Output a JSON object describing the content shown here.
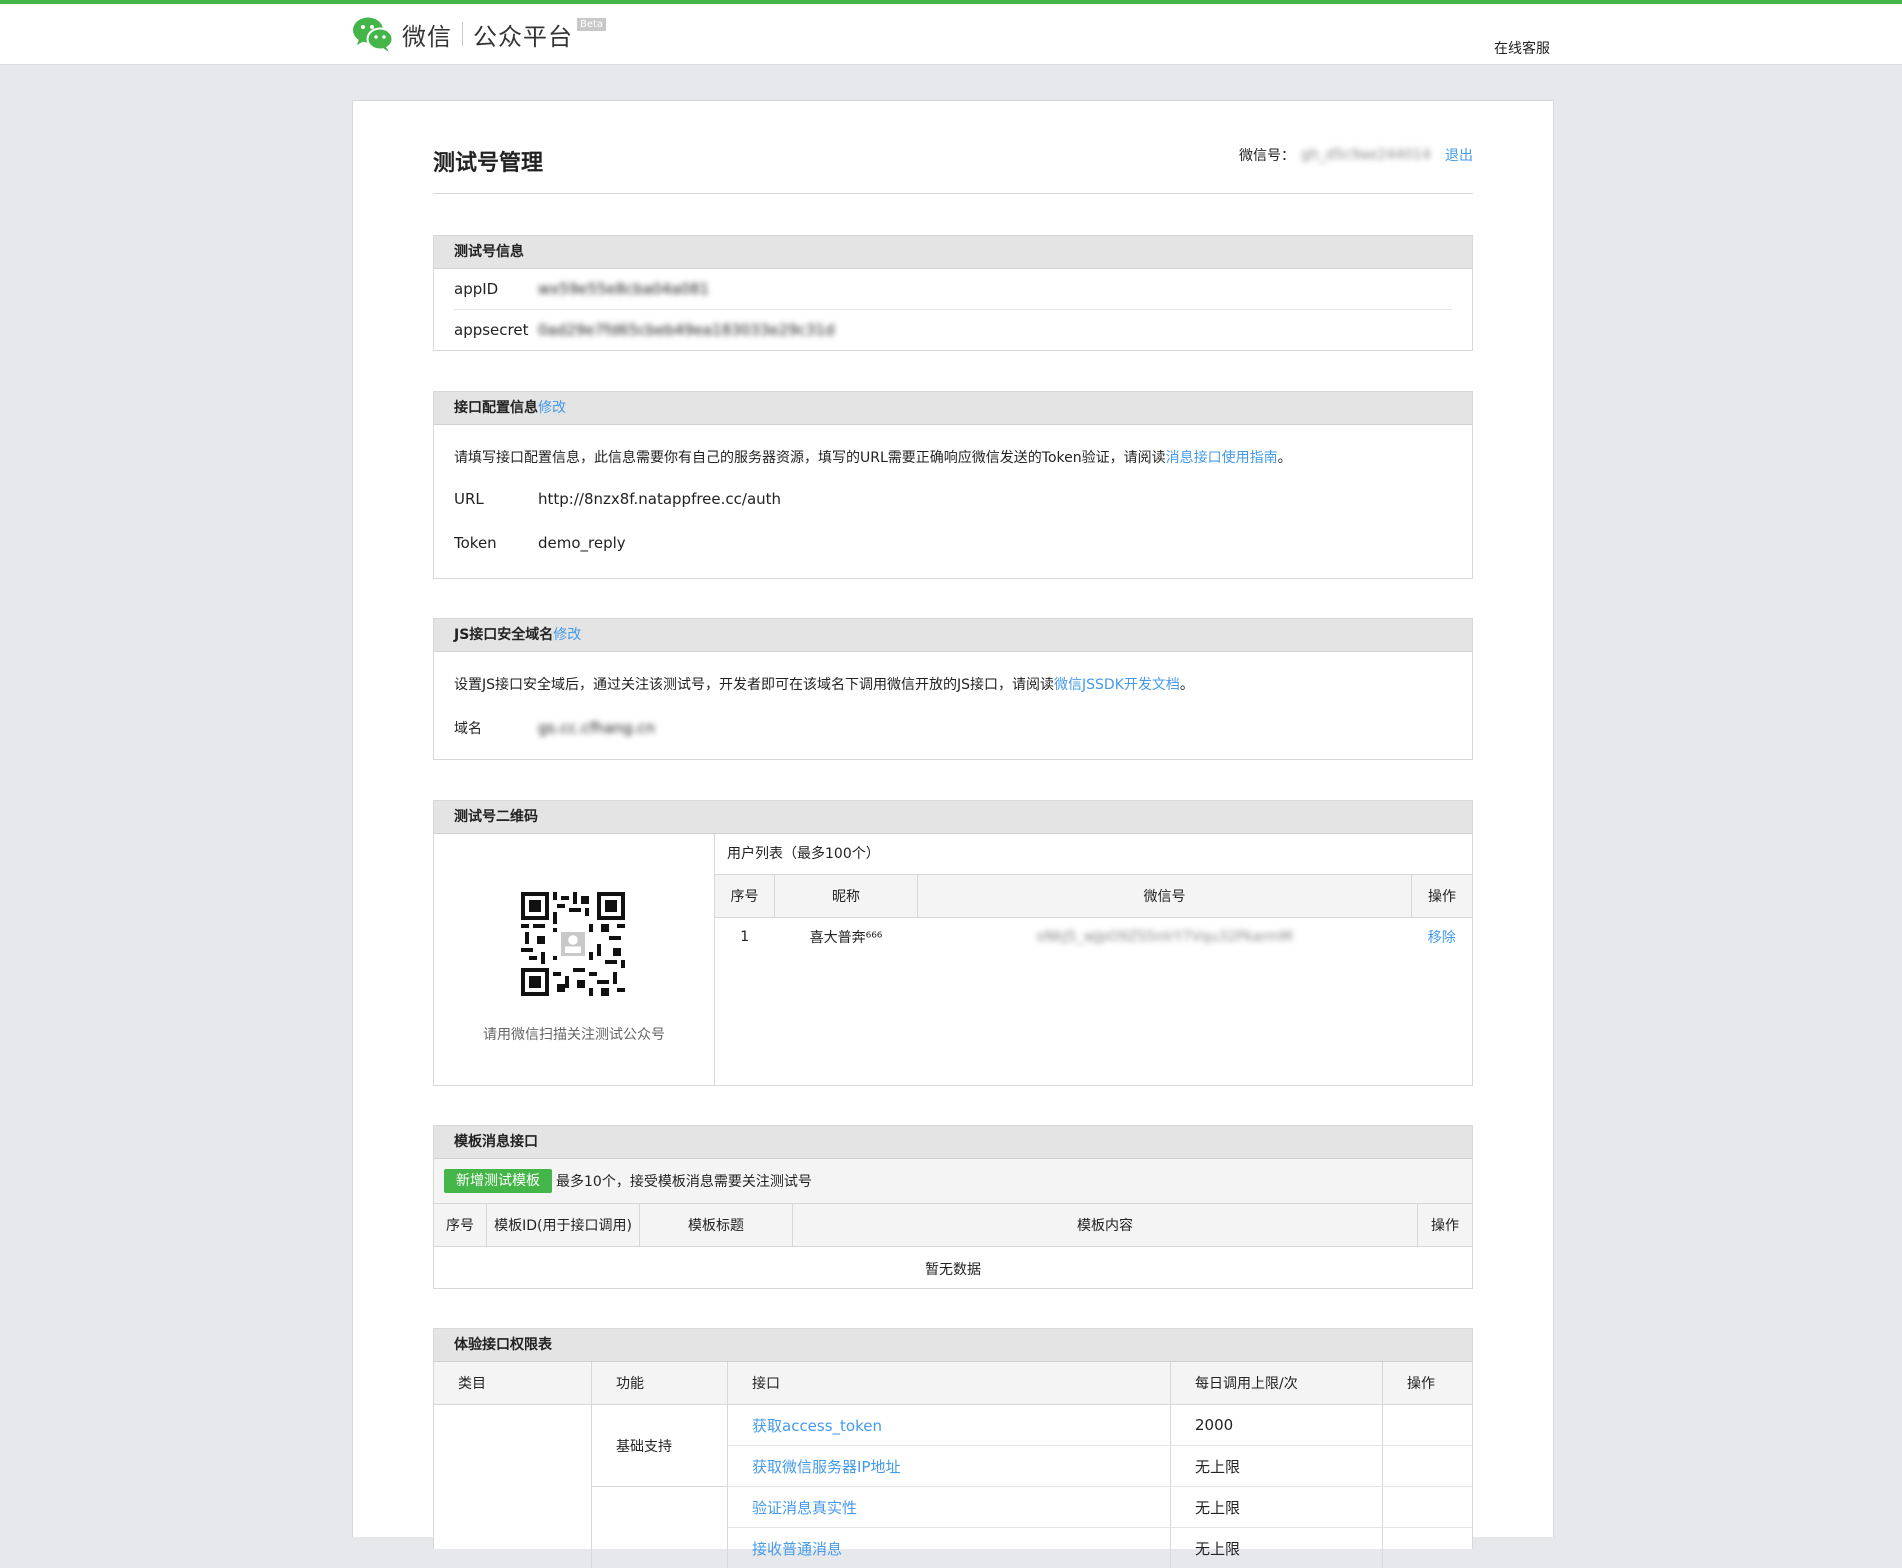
{
  "header": {
    "brand": "微信",
    "platform": "公众平台",
    "beta": "Beta",
    "help": "在线客服"
  },
  "page": {
    "title": "测试号管理",
    "account_label": "微信号：",
    "account_value": "gh_d5c9ae244014",
    "logout": "退出"
  },
  "test_info": {
    "title": "测试号信息",
    "appid_label": "appID",
    "appid_value": "wx59e55e8cba04a081",
    "secret_label": "appsecret",
    "secret_value": "0ad29e7fd65cbeb49ea183033e29c31d"
  },
  "api_config": {
    "title": "接口配置信息",
    "edit": "修改",
    "desc": "请填写接口配置信息，此信息需要你有自己的服务器资源，填写的URL需要正确响应微信发送的Token验证，请阅读",
    "desc_link": "消息接口使用指南",
    "desc_end": "。",
    "url_label": "URL",
    "url_value": "http://8nzx8f.natappfree.cc/auth",
    "token_label": "Token",
    "token_value": "demo_reply"
  },
  "js_domain": {
    "title": "JS接口安全域名",
    "edit": "修改",
    "desc": "设置JS接口安全域后，通过关注该测试号，开发者即可在该域名下调用微信开放的JS接口，请阅读",
    "desc_link": "微信JSSDK开发文档",
    "desc_end": "。",
    "domain_label": "域名",
    "domain_value": "gs.cc.cfhang.cn"
  },
  "qr": {
    "title": "测试号二维码",
    "caption": "请用微信扫描关注测试公众号",
    "list_title": "用户列表（最多100个）",
    "columns": [
      "序号",
      "昵称",
      "微信号",
      "操作"
    ],
    "rows": [
      {
        "no": "1",
        "nickname": "喜大普奔⁶⁶⁶",
        "wxid": "oNkJ5_wJpO9ZS5nlrY7Vqu32PkarmM",
        "action": "移除"
      }
    ]
  },
  "template": {
    "title": "模板消息接口",
    "add_button": "新增测试模板",
    "note": "最多10个，接受模板消息需要关注测试号",
    "columns": [
      "序号",
      "模板ID(用于接口调用)",
      "模板标题",
      "模板内容",
      "操作"
    ],
    "empty": "暂无数据"
  },
  "perm": {
    "title": "体验接口权限表",
    "columns": [
      "类目",
      "功能",
      "接口",
      "每日调用上限/次",
      "操作"
    ],
    "group1": "基础支持",
    "rows": [
      {
        "api": "获取access_token",
        "limit": "2000"
      },
      {
        "api": "获取微信服务器IP地址",
        "limit": "无上限"
      },
      {
        "api": "验证消息真实性",
        "limit": "无上限"
      },
      {
        "api": "接收普通消息",
        "limit": "无上限"
      }
    ]
  }
}
